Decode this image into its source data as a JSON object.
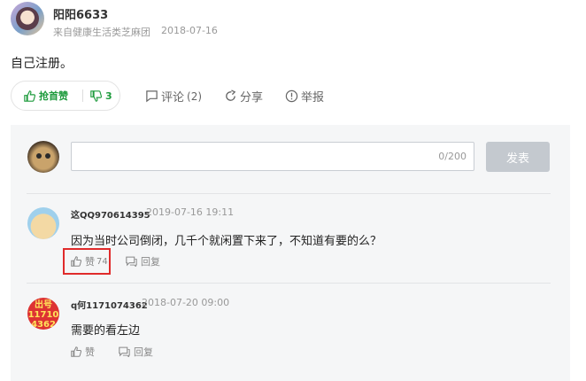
{
  "post": {
    "username": "阳阳6633",
    "source": "来自健康生活类芝麻团",
    "date": "2018-07-16",
    "content": "自己注册。"
  },
  "votes": {
    "up_label": "抢首赞",
    "down_count": "3"
  },
  "actions": {
    "comment_label": "评论",
    "comment_count": "(2)",
    "share_label": "分享",
    "report_label": "举报"
  },
  "comment_box": {
    "char_count": "0/200",
    "submit_label": "发表"
  },
  "comments": [
    {
      "name": "这QQ970614395",
      "time": "2019-07-16 19:11",
      "text": "因为当时公司倒闭，几千个就闲置下来了，不知道有要的么？",
      "like_label": "赞",
      "like_count": "74",
      "reply_label": "回复"
    },
    {
      "name": "q何1171074362",
      "time": "2018-07-20 09:00",
      "text": "需要的看左边",
      "like_label": "赞",
      "like_count": "",
      "reply_label": "回复",
      "avatar_text": [
        "出号",
        "11710",
        "4362"
      ]
    }
  ],
  "colors": {
    "accent_green": "#1e9b3d",
    "highlight_red": "#e02b2b",
    "panel_bg": "#f5f6f7",
    "submit_bg": "#c4c9cf"
  }
}
